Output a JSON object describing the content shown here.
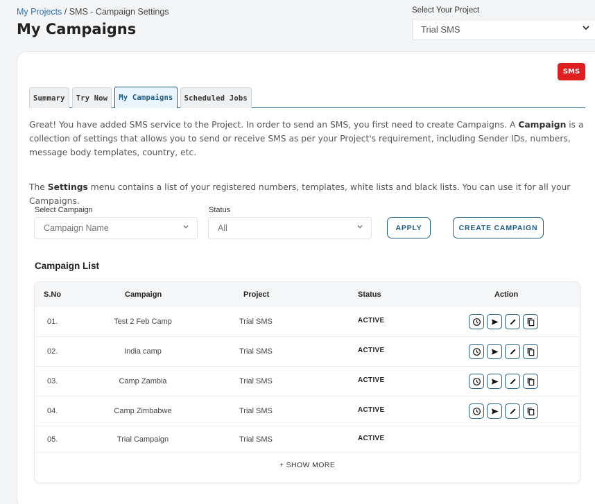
{
  "breadcrumb": {
    "link": "My Projects",
    "separator": " / ",
    "current": "SMS - Campaign Settings"
  },
  "page_title": "My Campaigns",
  "project_select": {
    "label": "Select Your Project",
    "value": "Trial SMS",
    "icon": "chevron-down-icon"
  },
  "badge": "SMS",
  "colors": {
    "accent": "#1e5d86",
    "badge": "#e02020",
    "link": "#2a6fb0"
  },
  "tabs": [
    {
      "label": "Summary",
      "active": false
    },
    {
      "label": "Try Now",
      "active": false
    },
    {
      "label": "My Campaigns",
      "active": true
    },
    {
      "label": "Scheduled Jobs",
      "active": false
    }
  ],
  "intro": {
    "p1_before": "Great! You have added SMS service to the Project. In order to send an SMS, you first need to create Campaigns. A ",
    "p1_bold": "Campaign",
    "p1_after": " is a collection of settings that allows you to send or receive SMS as per your Project's requirement, including Sender IDs, numbers, message body templates, country, etc.",
    "p2_before": "The ",
    "p2_bold": "Settings",
    "p2_after": " menu contains a list of your registered numbers, templates, white lists and black lists. You can use it for all your Campaigns."
  },
  "filters": {
    "campaign_label": "Select Campaign",
    "campaign_value": "Campaign Name",
    "status_label": "Status",
    "status_value": "All",
    "apply": "APPLY",
    "create": "CREATE CAMPAIGN"
  },
  "list_title": "Campaign List",
  "table": {
    "headers": {
      "sno": "S.No",
      "campaign": "Campaign",
      "project": "Project",
      "status": "Status",
      "action": "Action"
    },
    "rows": [
      {
        "sno": "01.",
        "campaign": "Test 2 Feb Camp",
        "project": "Trial SMS",
        "status": "ACTIVE"
      },
      {
        "sno": "02.",
        "campaign": "India camp",
        "project": "Trial SMS",
        "status": "ACTIVE"
      },
      {
        "sno": "03.",
        "campaign": "Camp Zambia",
        "project": "Trial SMS",
        "status": "ACTIVE"
      },
      {
        "sno": "04.",
        "campaign": "Camp Zimbabwe",
        "project": "Trial SMS",
        "status": "ACTIVE"
      },
      {
        "sno": "05.",
        "campaign": "Trial Campaign",
        "project": "Trial SMS",
        "status": "ACTIVE"
      }
    ],
    "action_icons": [
      "clock-icon",
      "send-icon",
      "pencil-icon",
      "copy-icon"
    ],
    "show_more": "+ SHOW MORE"
  }
}
